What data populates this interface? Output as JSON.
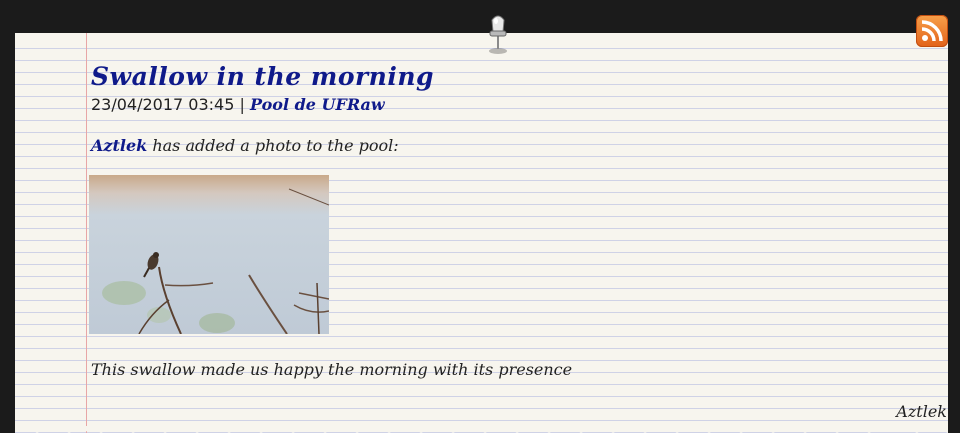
{
  "post": {
    "title": "Swallow in the morning",
    "date": "23/04/2017 03:45",
    "separator": "|",
    "pool": "Pool de UFRaw",
    "user": "Aztlek",
    "added_text": " has added a photo to the pool:",
    "caption": "This swallow made us happy the morning with its presence",
    "author": "Aztlek"
  },
  "colors": {
    "link": "#0f1a8a",
    "paper": "#f7f5ee",
    "rule": "#cfd2e6",
    "margin": "#e8a6a6",
    "rss": "#f28c2f"
  },
  "icons": {
    "pin": "push-pin-icon",
    "rss": "rss-feed-icon"
  }
}
